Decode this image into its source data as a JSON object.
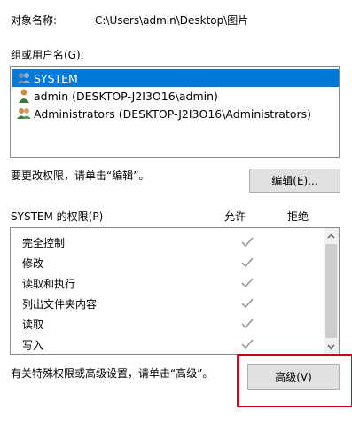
{
  "object": {
    "label": "对象名称:",
    "value": "C:\\Users\\admin\\Desktop\\图片"
  },
  "groups": {
    "label": "组或用户名(G):",
    "items": [
      {
        "name": "SYSTEM",
        "icon": "users-group-icon",
        "selected": true
      },
      {
        "name": "admin (DESKTOP-J2I3O16\\admin)",
        "icon": "user-icon",
        "selected": false
      },
      {
        "name": "Administrators (DESKTOP-J2I3O16\\Administrators)",
        "icon": "users-group-icon",
        "selected": false
      }
    ]
  },
  "edit": {
    "hint": "要更改权限，请单击“编辑”。",
    "button_label": "编辑(E)..."
  },
  "permissions": {
    "header": "SYSTEM 的权限(P)",
    "allow_label": "允许",
    "deny_label": "拒绝",
    "items": [
      {
        "name": "完全控制",
        "allow": true,
        "deny": false
      },
      {
        "name": "修改",
        "allow": true,
        "deny": false
      },
      {
        "name": "读取和执行",
        "allow": true,
        "deny": false
      },
      {
        "name": "列出文件夹内容",
        "allow": true,
        "deny": false
      },
      {
        "name": "读取",
        "allow": true,
        "deny": false
      },
      {
        "name": "写入",
        "allow": true,
        "deny": false
      }
    ]
  },
  "advanced": {
    "hint": "有关特殊权限或高级设置，请单击“高级”。",
    "button_label": "高级(V)"
  },
  "colors": {
    "selection": "#0078d7",
    "highlight_border": "#d0021b",
    "check": "#a0a0a0"
  }
}
